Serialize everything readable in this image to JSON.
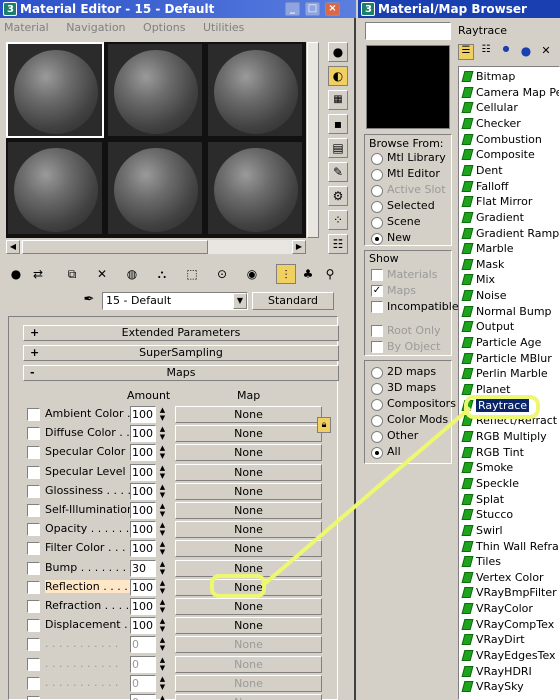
{
  "editor": {
    "title": "Material Editor - 15 - Default",
    "menu": [
      "Material",
      "Navigation",
      "Options",
      "Utilities"
    ],
    "material_name": "15 - Default",
    "material_type": "Standard",
    "rollouts": {
      "extended": "Extended Parameters",
      "supersampling": "SuperSampling",
      "maps": "Maps",
      "plus": "+",
      "minus": "-"
    },
    "maps_header": {
      "amount": "Amount",
      "map": "Map"
    },
    "maps": [
      {
        "label": "Ambient Color . . .",
        "amount": "100",
        "map": "None"
      },
      {
        "label": "Diffuse Color . . .",
        "amount": "100",
        "map": "None"
      },
      {
        "label": "Specular Color . .",
        "amount": "100",
        "map": "None"
      },
      {
        "label": "Specular Level . .",
        "amount": "100",
        "map": "None"
      },
      {
        "label": "Glossiness . . . . .",
        "amount": "100",
        "map": "None"
      },
      {
        "label": "Self-Illumination .",
        "amount": "100",
        "map": "None"
      },
      {
        "label": "Opacity . . . . . . .",
        "amount": "100",
        "map": "None"
      },
      {
        "label": "Filter Color . . . .",
        "amount": "100",
        "map": "None"
      },
      {
        "label": "Bump . . . . . . . .",
        "amount": "30",
        "map": "None"
      },
      {
        "label": "Reflection . . . .",
        "amount": "100",
        "map": "None"
      },
      {
        "label": "Refraction . . . .",
        "amount": "100",
        "map": "None"
      },
      {
        "label": "Displacement . . .",
        "amount": "100",
        "map": "None"
      },
      {
        "label": ". . . . . . . . . . .",
        "amount": "0",
        "map": "None"
      },
      {
        "label": ". . . . . . . . . . .",
        "amount": "0",
        "map": "None"
      },
      {
        "label": ". . . . . . . . . . .",
        "amount": "0",
        "map": "None"
      },
      {
        "label": ". . . . . . . . . . .",
        "amount": "0",
        "map": "None"
      }
    ]
  },
  "browser": {
    "title": "Material/Map Browser",
    "search_value": "",
    "selected_name": "Raytrace",
    "browse_from": {
      "title": "Browse From:",
      "options": [
        "Mtl Library",
        "Mtl Editor",
        "Active Slot",
        "Selected",
        "Scene",
        "New"
      ],
      "selected": "New"
    },
    "show": {
      "title": "Show",
      "materials": "Materials",
      "maps": "Maps",
      "incompatible": "Incompatible",
      "root_only": "Root Only",
      "by_object": "By Object"
    },
    "map_filter": {
      "options": [
        "2D maps",
        "3D maps",
        "Compositors",
        "Color Mods",
        "Other",
        "All"
      ],
      "selected": "All"
    },
    "items": [
      "Bitmap",
      "Camera Map Pe",
      "Cellular",
      "Checker",
      "Combustion",
      "Composite",
      "Dent",
      "Falloff",
      "Flat Mirror",
      "Gradient",
      "Gradient Ramp",
      "Marble",
      "Mask",
      "Mix",
      "Noise",
      "Normal Bump",
      "Output",
      "Particle Age",
      "Particle MBlur",
      "Perlin Marble",
      "Planet",
      "Raytrace",
      "Reflect/Refract",
      "RGB Multiply",
      "RGB Tint",
      "Smoke",
      "Speckle",
      "Splat",
      "Stucco",
      "Swirl",
      "Thin Wall Refrac",
      "Tiles",
      "Vertex Color",
      "VRayBmpFilter",
      "VRayColor",
      "VRayCompTex",
      "VRayDirt",
      "VRayEdgesTex",
      "VRayHDRI",
      "VRaySky"
    ],
    "selected_item": "Raytrace"
  },
  "colors": {
    "titlebar": "#1a3fb0",
    "highlight": "#eef770",
    "map_icon": "#1fa31f"
  }
}
